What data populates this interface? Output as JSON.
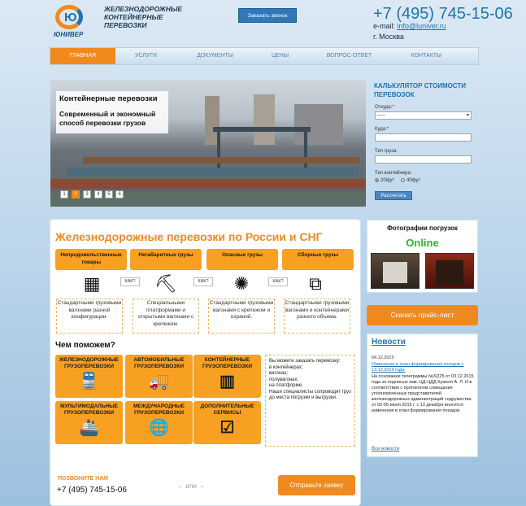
{
  "header": {
    "logo_mark": "Ю",
    "logo_text": "ЮНИВЕР",
    "tagline": "ЖЕЛЕЗНОДОРОЖНЫЕ КОНТЕЙНЕРНЫЕ ПЕРЕВОЗКИ",
    "callback_button": "Заказать звонок",
    "phone": "+7 (495) 745-15-06",
    "email_label": "e-mail:",
    "email": "info@luniver.ru",
    "city": "г. Москва"
  },
  "nav": [
    "ГЛАВНАЯ",
    "УСЛУГИ",
    "ДОКУМЕНТЫ",
    "ЦЕНЫ",
    "ВОПРОС-ОТВЕТ",
    "КОНТАКТЫ"
  ],
  "slider": {
    "caption_title": "Контейнерные перевозки",
    "caption_text": "Современный и экономный способ перевозки грузов",
    "dots": [
      "1",
      "2",
      "3",
      "4",
      "5",
      "6"
    ],
    "active_dot": 2
  },
  "calculator": {
    "title": "КАЛЬКУЛЯТОР СТОИМОСТИ ПЕРЕВОЗОК",
    "from_label": "Откуда:",
    "from_value": "-----",
    "to_label": "Куда:",
    "cargo_label": "Тип груза:",
    "container_label": "Тип контейнера:",
    "option_20": "20фут",
    "option_40": "40фут",
    "submit": "Рассчитать"
  },
  "main": {
    "title": "Железнодорожные перевозки по России и СНГ",
    "categories": [
      {
        "label": "Непродовольственные товары",
        "desc": "Стандартными грузовыми вагонами разной конфигурации."
      },
      {
        "label": "Негабаритные грузы",
        "desc": "Специальными платформами и открытыми вагонами с крепежом."
      },
      {
        "label": "Опасные грузы",
        "desc": "Стандартными грузовыми вагонами с крепежом и охраной."
      },
      {
        "label": "Сборные грузы",
        "desc": "Стандартными грузовыми вагонами и контейнерами разного объема."
      }
    ],
    "how_label": "КАК?",
    "help_title": "Чем поможем?",
    "services": [
      {
        "line1": "ЖЕЛЕЗНОДОРОЖНЫЕ",
        "line2": "ГРУЗОПЕРЕВОЗКИ"
      },
      {
        "line1": "АВТОМОБИЛЬНЫЕ",
        "line2": "ГРУЗОПЕРЕВОЗКИ"
      },
      {
        "line1": "КОНТЕЙНЕРНЫЕ",
        "line2": "ГРУЗОПЕРЕВОЗКИ"
      },
      {
        "line1": "МУЛЬТИМОДАЛЬНЫЕ",
        "line2": "ГРУЗОПЕРЕВОЗКИ"
      },
      {
        "line1": "МЕЖДУНАРОДНЫЕ",
        "line2": "ГРУЗОПЕРЕВОЗКИ"
      },
      {
        "line1": "ДОПОЛНИТЕЛЬНЫЕ",
        "line2": "СЕРВИСЫ"
      }
    ],
    "note": [
      "Вы можете заказать перевозку:",
      "в контейнерах;",
      "вагонах;",
      "полувагонах;",
      "на платформе.",
      "Наши специалисты сопроводят груз до места погрузки и выгрузки."
    ],
    "call_label": "ПОЗВОНИТЕ НАМ",
    "call_phone": "+7 (495) 745-15-06",
    "or_text": "← или →",
    "request_button": "Отправьте заявку"
  },
  "sidebar": {
    "photos_title": "Фотографии погрузок",
    "online": "Online",
    "price_button": "Скачать прайс-лист",
    "news_title": "Новости",
    "news_date": "04.12.2015",
    "news_link": "Изменения в план формирования поездов с 13.12.2015 года.",
    "news_body": "На основании телеграммы №3/225 от 03.12.2015 года за подписью зам. ЦД-ЦДД Кужеля А. Л. И в соответствии с протоколом совещания уполномоченных представителей железнодорожных администраций содружества от 02-05 июня 2015 г. с 13 декабря вносятся изменения в план формирования поездов.",
    "news_all": "Все новости"
  },
  "colors": {
    "accent": "#f08a1e",
    "brand": "#1d73b3",
    "online": "#2bb531"
  }
}
